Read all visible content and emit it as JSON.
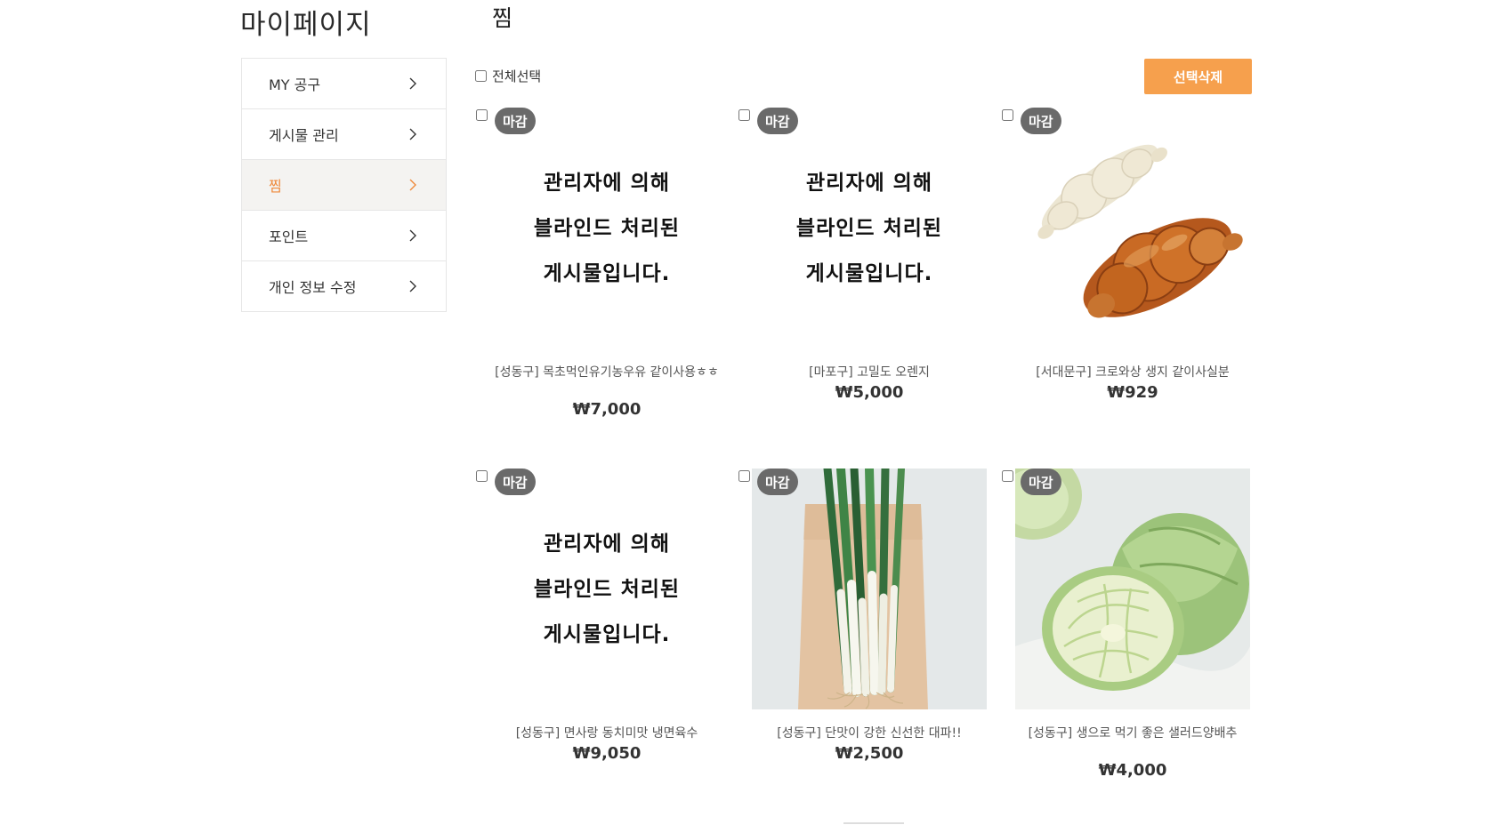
{
  "sidebar": {
    "title": "마이페이지",
    "items": [
      {
        "label": "MY 공구",
        "active": false
      },
      {
        "label": "게시물 관리",
        "active": false
      },
      {
        "label": "찜",
        "active": true
      },
      {
        "label": "포인트",
        "active": false
      },
      {
        "label": "개인 정보 수정",
        "active": false
      }
    ]
  },
  "main": {
    "title": "찜",
    "select_all_label": "전체선택",
    "delete_button": "선택삭제",
    "blind_text": [
      "관리자에 의해",
      "블라인드 처리된",
      "게시물입니다."
    ],
    "products": [
      {
        "badge": "마감",
        "name": "[성동구] 목초먹인유기농우유 같이사용ㅎㅎ",
        "price": "₩7,000",
        "image": "blind"
      },
      {
        "badge": "마감",
        "name": "[마포구] 고밀도 오렌지",
        "price": "₩5,000",
        "image": "blind"
      },
      {
        "badge": "마감",
        "name": "[서대문구] 크로와상 생지 같이사실분",
        "price": "₩929",
        "image": "croissant"
      },
      {
        "badge": "마감",
        "name": "[성동구] 면사랑 동치미맛 냉면육수",
        "price": "₩9,050",
        "image": "blind"
      },
      {
        "badge": "마감",
        "name": "[성동구] 단맛이 강한 신선한 대파!!",
        "price": "₩2,500",
        "image": "green-onion"
      },
      {
        "badge": "마감",
        "name": "[성동구] 생으로 먹기 좋은 샐러드양배추",
        "price": "₩4,000",
        "image": "cabbage"
      }
    ]
  },
  "colors": {
    "accent": "#f6a04d",
    "active_menu_text": "#ef8a3c",
    "badge_bg": "#6a6a6a"
  }
}
